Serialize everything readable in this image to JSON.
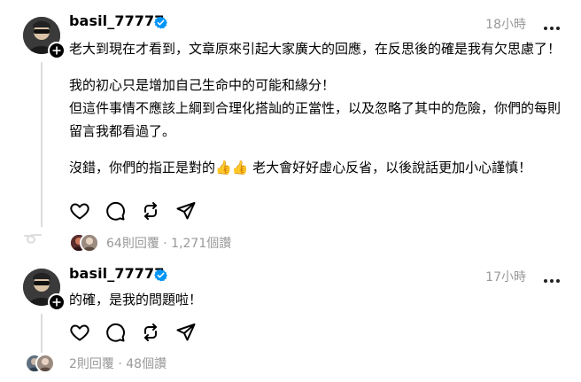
{
  "posts": [
    {
      "username": "basil_77777",
      "verified_icon": "verified-badge-icon",
      "timestamp": "18小時",
      "paragraphs": [
        "老大到現在才看到，文章原來引起大家廣大的回應，在反思後的確是我有欠思慮了！",
        "我的初心只是增加自己生命中的可能和緣分！",
        "但這件事情不應該上綱到合理化搭訕的正當性，以及忽略了其中的危險，你們的每則留言我都看過了。",
        "沒錯，你們的指正是對的",
        "老大會好好虛心反省，以後說話更加小心謹慎！"
      ],
      "emoji": "👍👍",
      "replies_text": "64則回覆 · 1,271個讚"
    },
    {
      "username": "basil_77777",
      "verified_icon": "verified-badge-icon",
      "timestamp": "17小時",
      "paragraphs": [
        "的確，是我的問題啦！"
      ],
      "replies_text": "2則回覆 · 48個讚"
    }
  ],
  "actions": [
    "heart-icon",
    "comment-icon",
    "repost-icon",
    "share-icon"
  ],
  "colors": {
    "verified": "#0095f6",
    "muted": "#999999",
    "line": "#dcdcdc",
    "thumb": "#f5b800"
  }
}
